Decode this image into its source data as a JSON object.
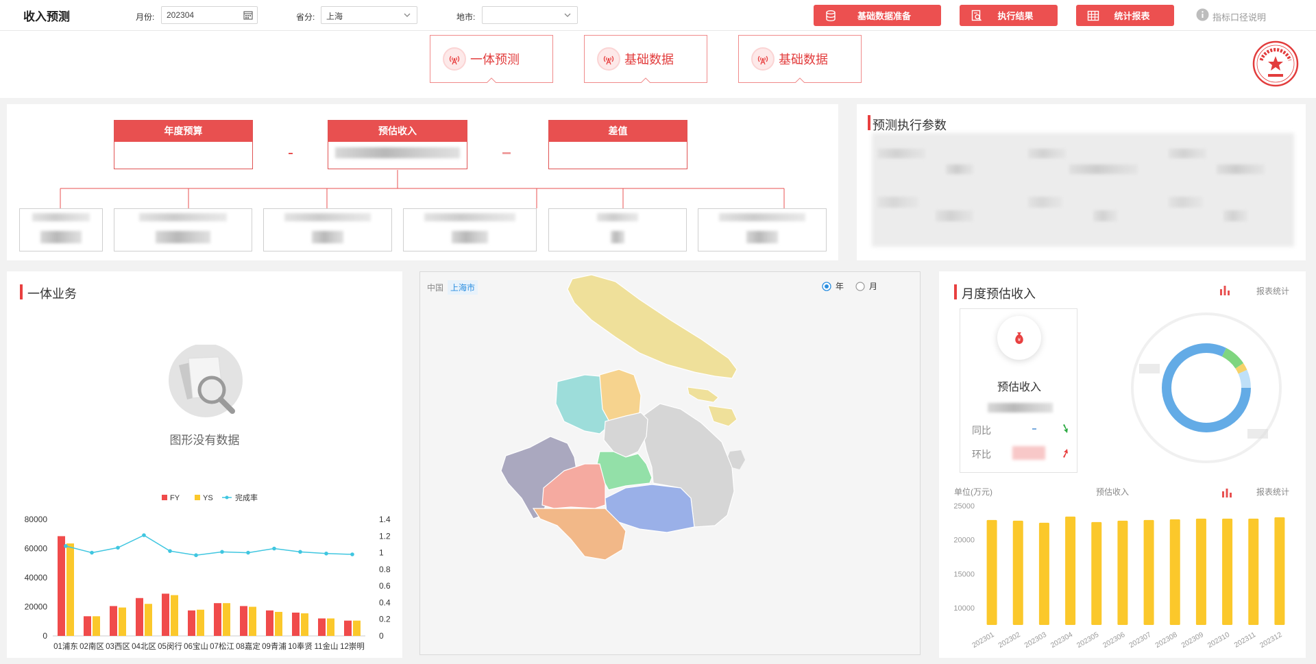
{
  "header": {
    "title": "收入预测",
    "month_label": "月份:",
    "month_value": "202304",
    "province_label": "省分:",
    "province_value": "上海",
    "city_label": "地市:",
    "city_value": "",
    "buttons": [
      "基础数据准备",
      "执行结果",
      "统计报表"
    ],
    "help_text": "指标口径说明"
  },
  "tabs": [
    "一体预测",
    "基础数据",
    "基础数据"
  ],
  "stamp_text": "上海移动分公司",
  "budget": {
    "headers": [
      "年度预算",
      "预估收入",
      "差值"
    ]
  },
  "params_panel": {
    "title": "预测执行参数"
  },
  "business_panel": {
    "title": "一体业务",
    "empty_text": "图形没有数据"
  },
  "map_panel": {
    "breadcrumb_root": "中国",
    "breadcrumb_current": "上海市",
    "radio_year": "年",
    "radio_month": "月",
    "selected": "年"
  },
  "monthly_panel": {
    "title": "月度预估收入",
    "report_link": "报表统计",
    "card_title": "预估收入",
    "yoy_label": "同比",
    "mom_label": "环比",
    "unit_label": "单位(万元)",
    "bar_title": "预估收入",
    "report_link2": "报表统计"
  },
  "colors": {
    "accent": "#e84040",
    "fy": "#f04b4b",
    "ys": "#fbc82b",
    "rate": "#3fc6e0",
    "monthly_bar": "#fbc82b"
  },
  "chart_data": [
    {
      "type": "bar",
      "legend": [
        "FY",
        "YS",
        "完成率"
      ],
      "categories": [
        "01浦东",
        "02南区",
        "03西区",
        "04北区",
        "05闵行",
        "06宝山",
        "07松江",
        "08嘉定",
        "09青浦",
        "10奉贤",
        "11金山",
        "12崇明"
      ],
      "series": [
        {
          "name": "FY",
          "values": [
            68500,
            13500,
            20500,
            26000,
            29000,
            17500,
            22500,
            20500,
            17500,
            16000,
            12000,
            10500
          ]
        },
        {
          "name": "YS",
          "values": [
            63500,
            13500,
            19500,
            22000,
            28000,
            18000,
            22500,
            20000,
            16500,
            15500,
            12000,
            10500
          ]
        },
        {
          "name": "完成率",
          "axis": "right",
          "values": [
            1.08,
            1.0,
            1.06,
            1.21,
            1.02,
            0.97,
            1.01,
            1.0,
            1.05,
            1.01,
            0.99,
            0.98
          ]
        }
      ],
      "ylim": [
        0,
        80000
      ],
      "y_ticks": [
        0,
        20000,
        40000,
        60000,
        80000
      ],
      "y2lim": [
        0,
        1.4
      ],
      "y2_ticks": [
        0,
        0.2,
        0.4,
        0.6,
        0.8,
        1,
        1.2,
        1.4
      ],
      "legend_position": "top"
    },
    {
      "type": "bar",
      "title": "预估收入",
      "ylabel": "单位(万元)",
      "categories": [
        "202301",
        "202302",
        "202303",
        "202304",
        "202305",
        "202306",
        "202307",
        "202308",
        "202309",
        "202310",
        "202311",
        "202312"
      ],
      "values": [
        22900,
        22800,
        22500,
        23400,
        22600,
        22800,
        22900,
        23000,
        23100,
        23100,
        23100,
        23300
      ],
      "ylim": [
        7500,
        25000
      ],
      "y_ticks": [
        10000,
        15000,
        20000,
        25000
      ]
    }
  ]
}
